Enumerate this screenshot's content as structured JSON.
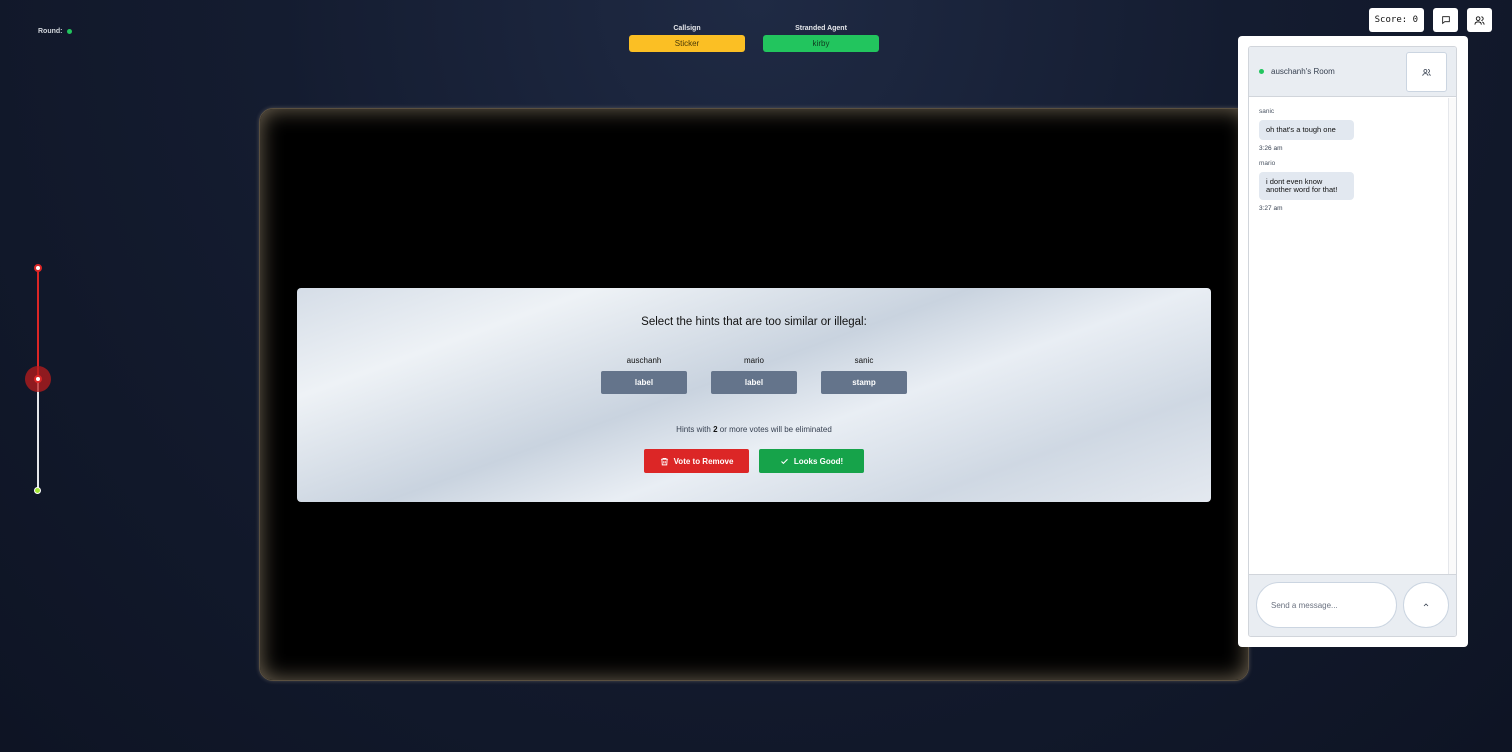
{
  "round": {
    "label": "Round:",
    "status_color": "#22c55e"
  },
  "header": {
    "callsign_label": "Callsign",
    "callsign_value": "Sticker",
    "agent_label": "Stranded Agent",
    "agent_value": "kirby"
  },
  "top_right": {
    "score_text": "Score: 0",
    "chat_icon": "chat-bubble-icon",
    "users_icon": "users-icon"
  },
  "slider": {
    "level": 0.5,
    "active_color": "#dc2626"
  },
  "panel": {
    "heading": "Select the hints that are too similar or illegal:",
    "hints": [
      {
        "player": "auschanh",
        "word": "label"
      },
      {
        "player": "mario",
        "word": "label"
      },
      {
        "player": "sanic",
        "word": "stamp"
      }
    ],
    "rule_prefix": "Hints with ",
    "rule_count": "2",
    "rule_suffix": " or more votes will be eliminated",
    "vote_button": "Vote to Remove",
    "vote_icon": "trash-icon",
    "ok_button": "Looks Good!",
    "ok_icon": "check-icon"
  },
  "chat": {
    "room_name": "auschanh's Room",
    "messages": [
      {
        "from": "sanic",
        "text": "oh that's a tough one",
        "time": "3:26 am"
      },
      {
        "from": "mario",
        "text": "i dont even know another word for that!",
        "time": "3:27 am"
      }
    ],
    "input_placeholder": "Send a message...",
    "send_icon": "chevron-up-icon"
  }
}
